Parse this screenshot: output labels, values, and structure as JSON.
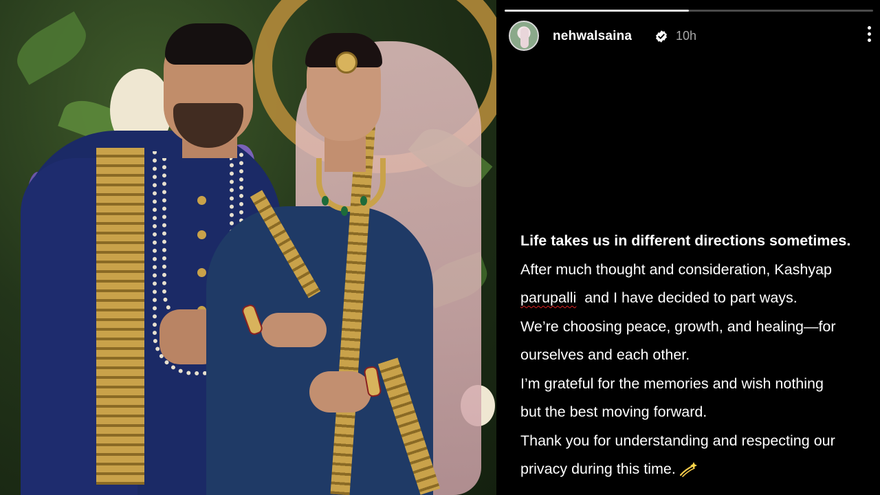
{
  "story": {
    "username": "nehwalsaina",
    "time": "10h",
    "progress": 0.5,
    "caption": {
      "line1": "Life takes us in different directions sometimes.",
      "line2": "After much thought and consideration, Kashyap",
      "line3_name": "parupalli",
      "line3_rest": "  and I have decided to part ways.",
      "line4": "We’re choosing peace, growth, and healing—for",
      "line5": "ourselves and each other.",
      "line6": "I’m grateful for the memories and wish nothing",
      "line7": "but the best moving forward.",
      "line8": "Thank you for understanding and respecting our",
      "line9": "privacy during this time."
    },
    "icons": {
      "verified": "verified-badge-icon",
      "more": "more-options-icon",
      "emoji": "dizzy-sparkle-emoji"
    }
  },
  "colors": {
    "background": "#000000",
    "text": "#ffffff",
    "muted": "#a8a8a8",
    "verified": "#ffffff"
  }
}
